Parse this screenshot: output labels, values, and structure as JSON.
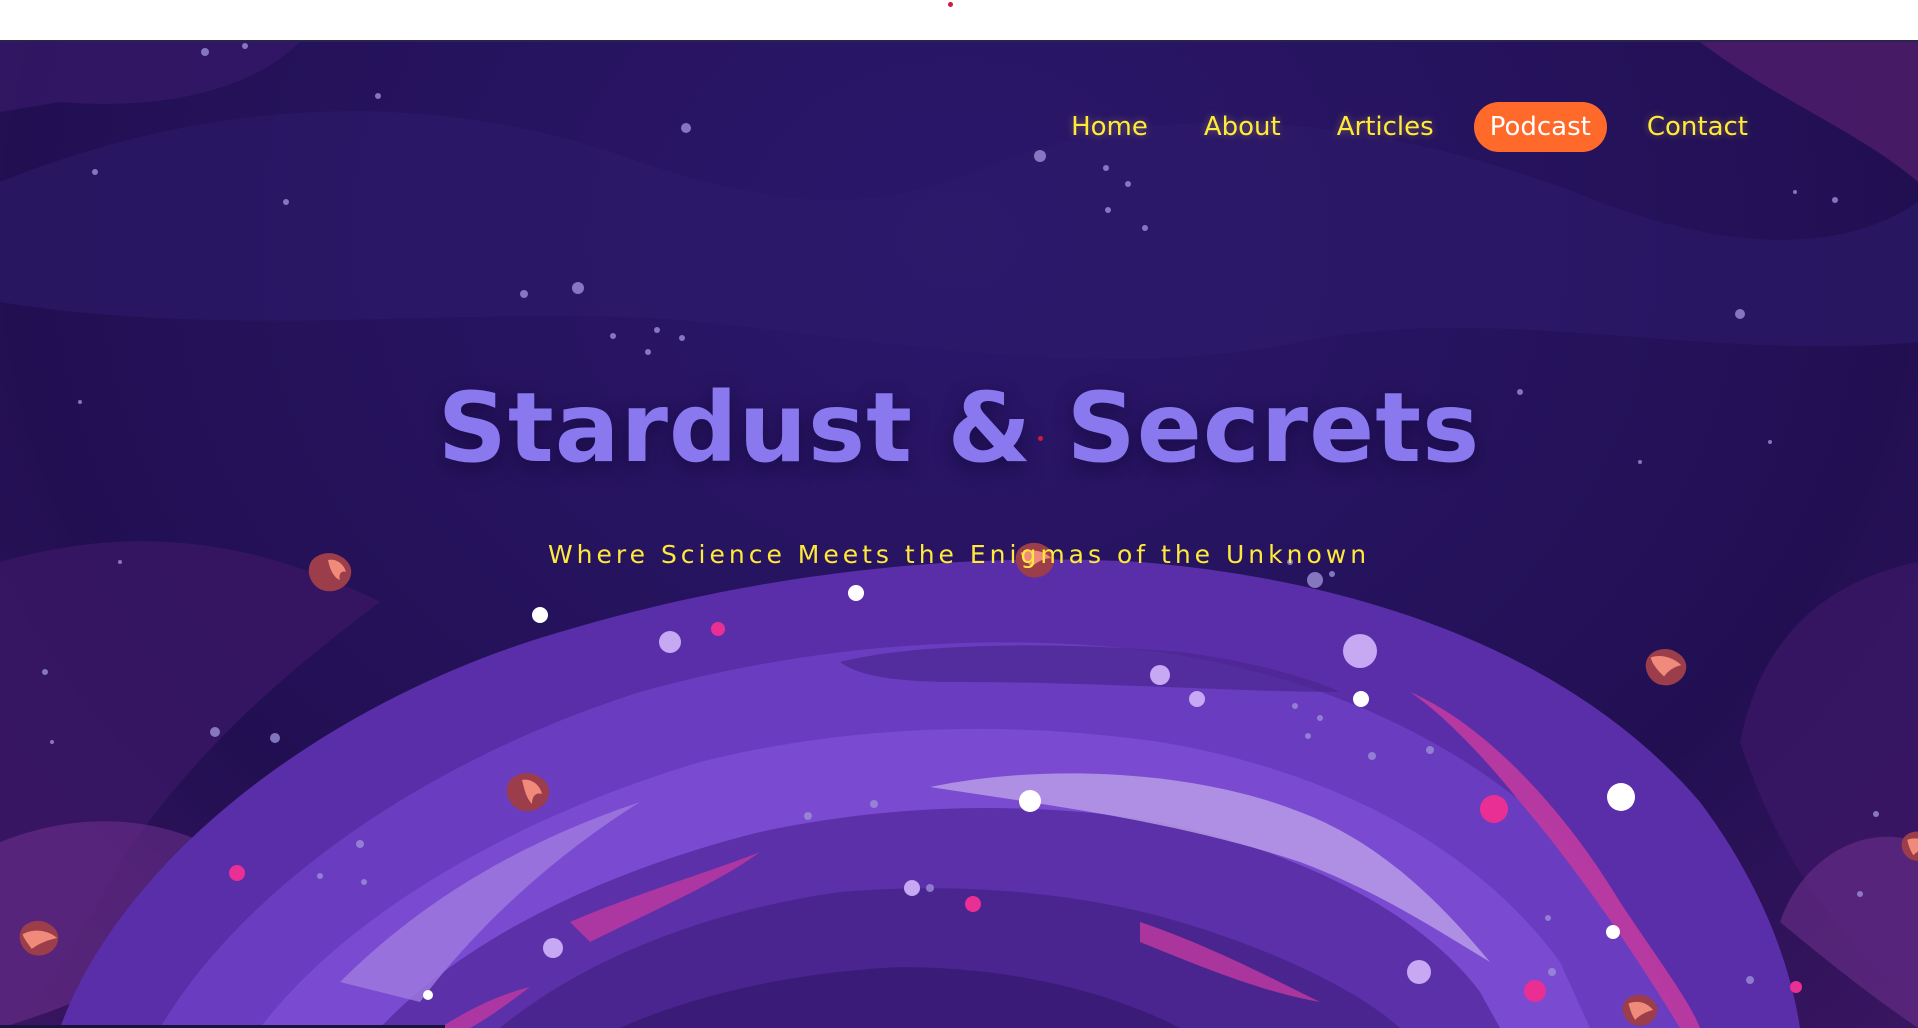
{
  "nav": {
    "items": [
      {
        "label": "Home",
        "active": false
      },
      {
        "label": "About",
        "active": false
      },
      {
        "label": "Articles",
        "active": false
      },
      {
        "label": "Podcast",
        "active": true
      },
      {
        "label": "Contact",
        "active": false
      }
    ]
  },
  "hero": {
    "title": "Stardust & Secrets",
    "subtitle": "Where Science Meets the Enigmas of the Unknown"
  },
  "colors": {
    "background": "#26135e",
    "title": "#8a78ee",
    "subtitle": "#ffe93a",
    "nav_text": "#ffea3a",
    "nav_active_bg": "#ff6a2a",
    "galaxy_light": "#9b6ee0",
    "galaxy_pink": "#e03aa0"
  },
  "icons": {
    "asteroids": "asteroid-icon",
    "galaxy": "galaxy-illustration"
  }
}
